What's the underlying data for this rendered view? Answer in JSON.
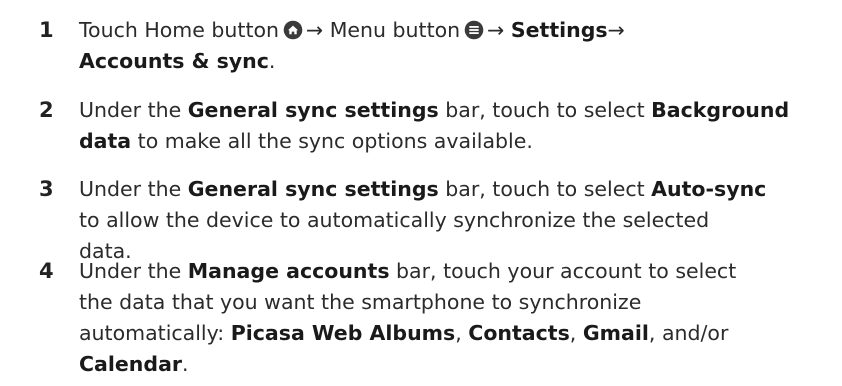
{
  "steps": [
    {
      "number": "1",
      "segments": [
        {
          "t": "Touch Home button"
        },
        {
          "icon": "home-icon"
        },
        {
          "t": "→ Menu button"
        },
        {
          "icon": "menu-icon"
        },
        {
          "t": "→ "
        },
        {
          "b": "Settings"
        },
        {
          "t": "→"
        },
        {
          "br": true
        },
        {
          "b": "Accounts & sync"
        },
        {
          "t": "."
        }
      ]
    },
    {
      "number": "2",
      "segments": [
        {
          "t": "Under the "
        },
        {
          "b": "General sync settings"
        },
        {
          "t": " bar, touch to select "
        },
        {
          "b": "Background"
        },
        {
          "br": true
        },
        {
          "b": "data"
        },
        {
          "t": " to make all the sync options available."
        }
      ]
    },
    {
      "number": "3",
      "segments": [
        {
          "t": "Under the "
        },
        {
          "b": "General sync settings"
        },
        {
          "t": " bar, touch to select "
        },
        {
          "b": "Auto-sync"
        },
        {
          "br": true
        },
        {
          "t": "to allow the device to automatically synchronize the selected"
        },
        {
          "br": true
        },
        {
          "t": "data."
        }
      ]
    },
    {
      "number": "4",
      "segments": [
        {
          "t": "Under the "
        },
        {
          "b": "Manage accounts"
        },
        {
          "t": " bar, touch your account to select"
        },
        {
          "br": true
        },
        {
          "t": "the data that you want the smartphone to synchronize"
        },
        {
          "br": true
        },
        {
          "t": "automatically: "
        },
        {
          "b": "Picasa Web Albums"
        },
        {
          "t": ", "
        },
        {
          "b": "Contacts"
        },
        {
          "t": ", "
        },
        {
          "b": "Gmail"
        },
        {
          "t": ", and/or"
        },
        {
          "br": true
        },
        {
          "b": "Calendar"
        },
        {
          "t": "."
        }
      ]
    }
  ]
}
